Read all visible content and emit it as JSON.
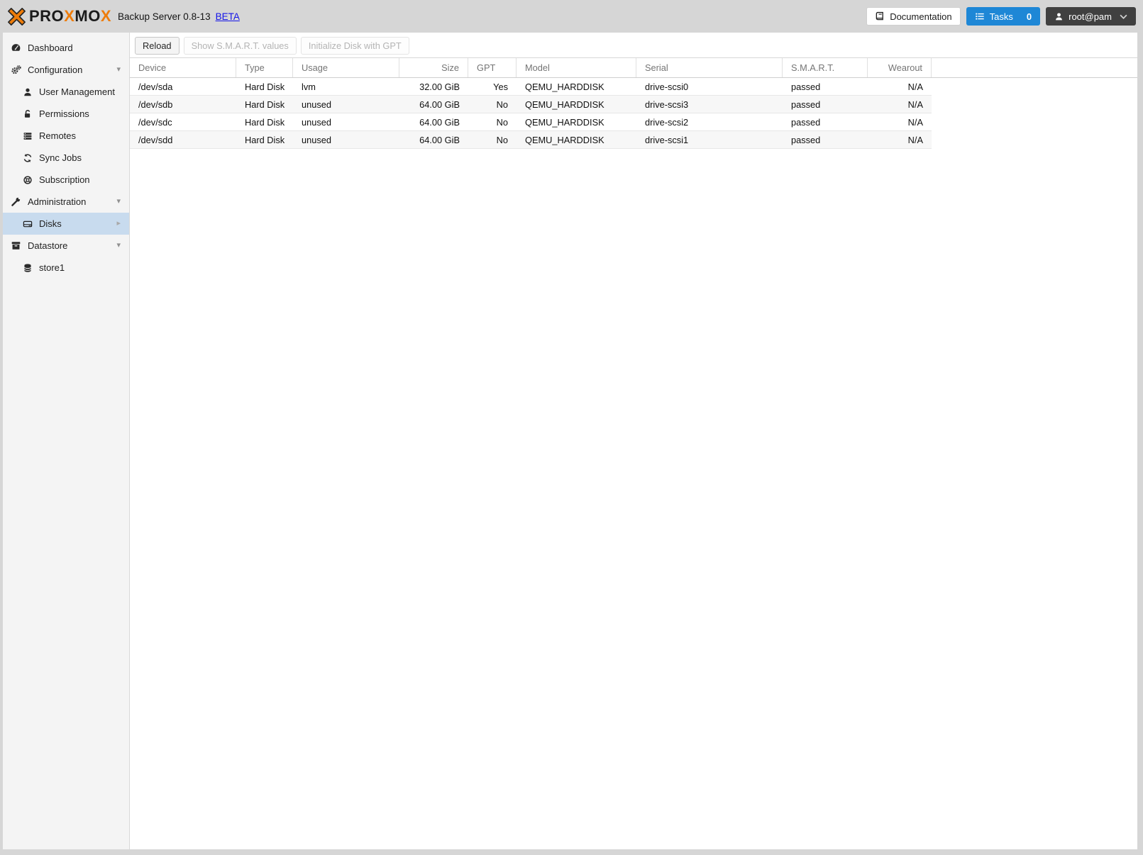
{
  "header": {
    "logo": {
      "part1": "PRO",
      "part2": "X",
      "part3": "MO",
      "part4": "X"
    },
    "title": "Backup Server 0.8-13",
    "beta_label": "BETA",
    "documentation_label": "Documentation",
    "tasks_label": "Tasks",
    "tasks_count": "0",
    "user_label": "root@pam"
  },
  "sidebar": {
    "items": [
      {
        "label": "Dashboard",
        "icon": "tachometer"
      },
      {
        "label": "Configuration",
        "icon": "gears",
        "expanded": true
      },
      {
        "label": "User Management",
        "icon": "user"
      },
      {
        "label": "Permissions",
        "icon": "unlock"
      },
      {
        "label": "Remotes",
        "icon": "server"
      },
      {
        "label": "Sync Jobs",
        "icon": "sync"
      },
      {
        "label": "Subscription",
        "icon": "life-ring"
      },
      {
        "label": "Administration",
        "icon": "wrench",
        "expanded": true
      },
      {
        "label": "Disks",
        "icon": "hdd",
        "selected": true
      },
      {
        "label": "Datastore",
        "icon": "archive",
        "expanded": true
      },
      {
        "label": "store1",
        "icon": "database"
      }
    ]
  },
  "toolbar": {
    "reload_label": "Reload",
    "smart_label": "Show S.M.A.R.T. values",
    "gpt_label": "Initialize Disk with GPT"
  },
  "table": {
    "columns": [
      {
        "key": "device",
        "label": "Device"
      },
      {
        "key": "type",
        "label": "Type"
      },
      {
        "key": "usage",
        "label": "Usage"
      },
      {
        "key": "size",
        "label": "Size"
      },
      {
        "key": "gpt",
        "label": "GPT"
      },
      {
        "key": "model",
        "label": "Model"
      },
      {
        "key": "serial",
        "label": "Serial"
      },
      {
        "key": "smart",
        "label": "S.M.A.R.T."
      },
      {
        "key": "wearout",
        "label": "Wearout"
      }
    ],
    "rows": [
      [
        "/dev/sda",
        "Hard Disk",
        "lvm",
        "32.00 GiB",
        "Yes",
        "QEMU_HARDDISK",
        "drive-scsi0",
        "passed",
        "N/A"
      ],
      [
        "/dev/sdb",
        "Hard Disk",
        "unused",
        "64.00 GiB",
        "No",
        "QEMU_HARDDISK",
        "drive-scsi3",
        "passed",
        "N/A"
      ],
      [
        "/dev/sdc",
        "Hard Disk",
        "unused",
        "64.00 GiB",
        "No",
        "QEMU_HARDDISK",
        "drive-scsi2",
        "passed",
        "N/A"
      ],
      [
        "/dev/sdd",
        "Hard Disk",
        "unused",
        "64.00 GiB",
        "No",
        "QEMU_HARDDISK",
        "drive-scsi1",
        "passed",
        "N/A"
      ]
    ]
  },
  "colors": {
    "orange": "#ee7c0a",
    "tasks-blue": "#1e87d6",
    "selected-blue": "#c8dbee",
    "link-blue": "#1414e8",
    "header-bg": "#d6d6d6",
    "sidebar-bg": "#f4f4f4"
  }
}
